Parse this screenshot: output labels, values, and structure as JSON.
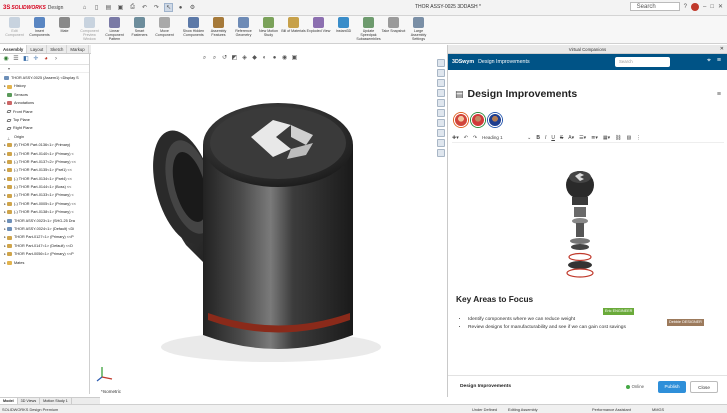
{
  "app": {
    "logo_mark": "3S",
    "logo_text": "SOLIDWORKS",
    "logo_sub": "Design",
    "document_title": "THOR ASSY-0025 3DDASH *",
    "search_placeholder": "Search"
  },
  "ribbon": [
    {
      "label": "Edit Component",
      "dim": true,
      "color": "#8fa6c2"
    },
    {
      "label": "Insert Components",
      "color": "#5a86c2"
    },
    {
      "label": "Mate",
      "color": "#8a8a8a"
    },
    {
      "label": "Component Preview Window",
      "dim": true,
      "color": "#8fa6c2"
    },
    {
      "label": "Linear Component Pattern",
      "color": "#7a7aa6"
    },
    {
      "label": "Smart Fasteners",
      "color": "#6d8d9c"
    },
    {
      "label": "Move Component",
      "color": "#a9a9a9"
    },
    {
      "label": "Show Hidden Components",
      "color": "#5c79a8"
    },
    {
      "label": "Assembly Features",
      "color": "#a67a3a"
    },
    {
      "label": "Reference Geometry",
      "color": "#6e8bb6"
    },
    {
      "label": "New Motion Study",
      "color": "#7ba25a"
    },
    {
      "label": "Bill of Materials",
      "color": "#c7a14a"
    },
    {
      "label": "Exploded View",
      "color": "#8c6fb0"
    },
    {
      "label": "Instant3D",
      "color": "#3a8dc9"
    },
    {
      "label": "Update Speedpak Subassemblies",
      "color": "#6e9b6e"
    },
    {
      "label": "Take Snapshot",
      "color": "#9b9b9b"
    },
    {
      "label": "Large Assembly Settings",
      "color": "#7a8fa6"
    }
  ],
  "tabs": [
    "Assembly",
    "Layout",
    "Sketch",
    "Markup",
    "Evaluate",
    "SOLIDWORKS Add-Ins",
    "Simulation",
    "MBD"
  ],
  "tree": [
    {
      "label": "THOR ASSY-0025 (Assem1) <Display S",
      "icon": "asm",
      "exp": ""
    },
    {
      "label": "History",
      "icon": "folder",
      "exp": "▸"
    },
    {
      "label": "Sensors",
      "icon": "sensor",
      "exp": ""
    },
    {
      "label": "Annotations",
      "icon": "annot",
      "exp": "▸"
    },
    {
      "label": "Front Plane",
      "icon": "plane",
      "exp": ""
    },
    {
      "label": "Top Plane",
      "icon": "plane",
      "exp": ""
    },
    {
      "label": "Right Plane",
      "icon": "plane",
      "exp": ""
    },
    {
      "label": "Origin",
      "icon": "origin",
      "exp": ""
    },
    {
      "label": "(f) THOR Part-0136<1> (Primary)",
      "icon": "part",
      "exp": "▸"
    },
    {
      "label": "(-) THOR Part-0140<1> (Primary) <",
      "icon": "part",
      "exp": "▸"
    },
    {
      "label": "(-) THOR Part-0137<2> (Primary) <<",
      "icon": "part",
      "exp": "▸"
    },
    {
      "label": "(-) THOR Part-0135<1> (Part1) <<",
      "icon": "part",
      "exp": "▸"
    },
    {
      "label": "(-) THOR Part-0134<1> (Part4) <<",
      "icon": "part",
      "exp": "▸"
    },
    {
      "label": "(-) THOR Part-0144<1> (Boss) <<",
      "icon": "part",
      "exp": "▸"
    },
    {
      "label": "(-) THOR Part-0133<1> (Primary) <",
      "icon": "part",
      "exp": "▸"
    },
    {
      "label": "(-) THOR Part-0005<1> (Primary) <<",
      "icon": "part",
      "exp": "▸"
    },
    {
      "label": "(-) THOR Part-0138<1> (Primary) <",
      "icon": "part",
      "exp": "▸"
    },
    {
      "label": "THOR ASSY-0023<1> (SHG-25 Dra",
      "icon": "asm",
      "exp": "▸"
    },
    {
      "label": "THOR ASSY-0024<1> (Default) <Di",
      "icon": "asm",
      "exp": "▸"
    },
    {
      "label": "THOR Part-0127<1> (Primary) <<P",
      "icon": "part",
      "exp": "▸"
    },
    {
      "label": "THOR Part-0147<1> (Default) <<D",
      "icon": "part",
      "exp": "▸"
    },
    {
      "label": "THOR Part-0056<1> (Primary) <<P",
      "icon": "part",
      "exp": "▸"
    },
    {
      "label": "Mates",
      "icon": "folder",
      "exp": "▸"
    }
  ],
  "viewport": {
    "view_label": "*Isometric"
  },
  "bottom_tabs": [
    "Model",
    "3D Views",
    "Motion Study 1"
  ],
  "status": {
    "left": "SOLIDWORKS Design Premium",
    "under_defined": "Under Defined",
    "editing": "Editing Assembly",
    "assistant": "Performance Assistant",
    "units": "MMGS"
  },
  "companion": {
    "window_title": "Virtual Companions",
    "brand": "3DSwym",
    "page": "Design Improvements",
    "search_placeholder": "Search",
    "doc_title": "Design Improvements",
    "heading_select": "Heading 1",
    "section_title": "Key Areas to Focus",
    "bullets": [
      "Identify components where we can reduce weight",
      "Review designs for manufacturability and see if we can gain cost savings"
    ],
    "tag_engineer": "Eric ENGINEER",
    "tag_designer": "Debbie DESIGNER",
    "footer_name": "Design Improvements",
    "online": "Online",
    "publish": "Publish",
    "close": "Close"
  }
}
